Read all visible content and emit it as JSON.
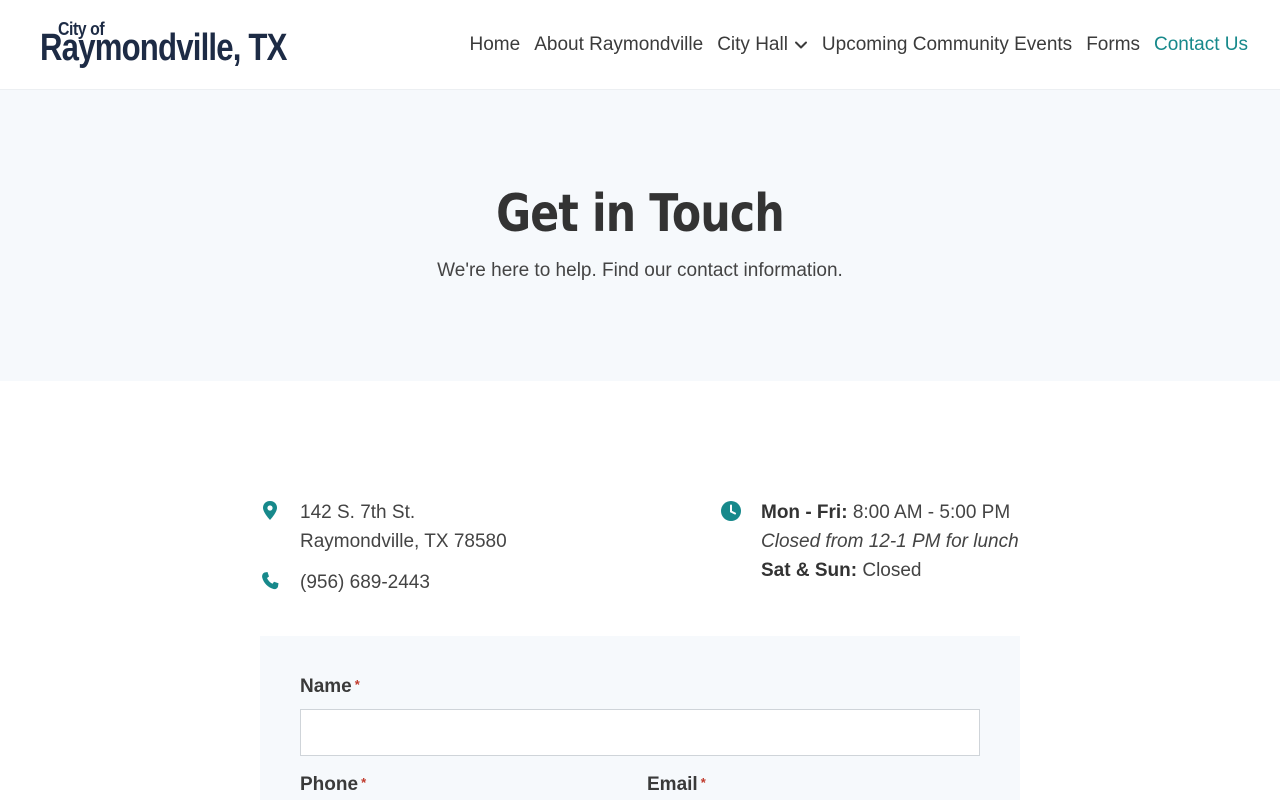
{
  "header": {
    "logo_small": "City of",
    "logo_big": "Raymondville, TX",
    "nav": [
      {
        "label": "Home",
        "active": false
      },
      {
        "label": "About Raymondville",
        "active": false
      },
      {
        "label": "City Hall",
        "active": false,
        "has_dropdown": true
      },
      {
        "label": "Upcoming Community Events",
        "active": false
      },
      {
        "label": "Forms",
        "active": false
      },
      {
        "label": "Contact Us",
        "active": true
      }
    ]
  },
  "hero": {
    "title": "Get in Touch",
    "subtitle": "We're here to help. Find our contact information."
  },
  "contact": {
    "address_line1": "142 S. 7th St.",
    "address_line2": "Raymondville, TX 78580",
    "phone": "(956) 689-2443"
  },
  "hours": {
    "weekday_label": "Mon - Fri:",
    "weekday_hours": "8:00 AM - 5:00 PM",
    "lunch_note": "Closed from 12-1 PM for lunch",
    "weekend_label": "Sat & Sun:",
    "weekend_hours": "Closed"
  },
  "form": {
    "name_label": "Name",
    "phone_label": "Phone",
    "email_label": "Email",
    "required_mark": "*",
    "name_value": ""
  },
  "colors": {
    "accent": "#17898b",
    "logo": "#1d2b45",
    "hero_bg": "#f6f9fc"
  },
  "icons": [
    "location-pin-icon",
    "phone-icon",
    "clock-icon",
    "chevron-down-icon"
  ]
}
